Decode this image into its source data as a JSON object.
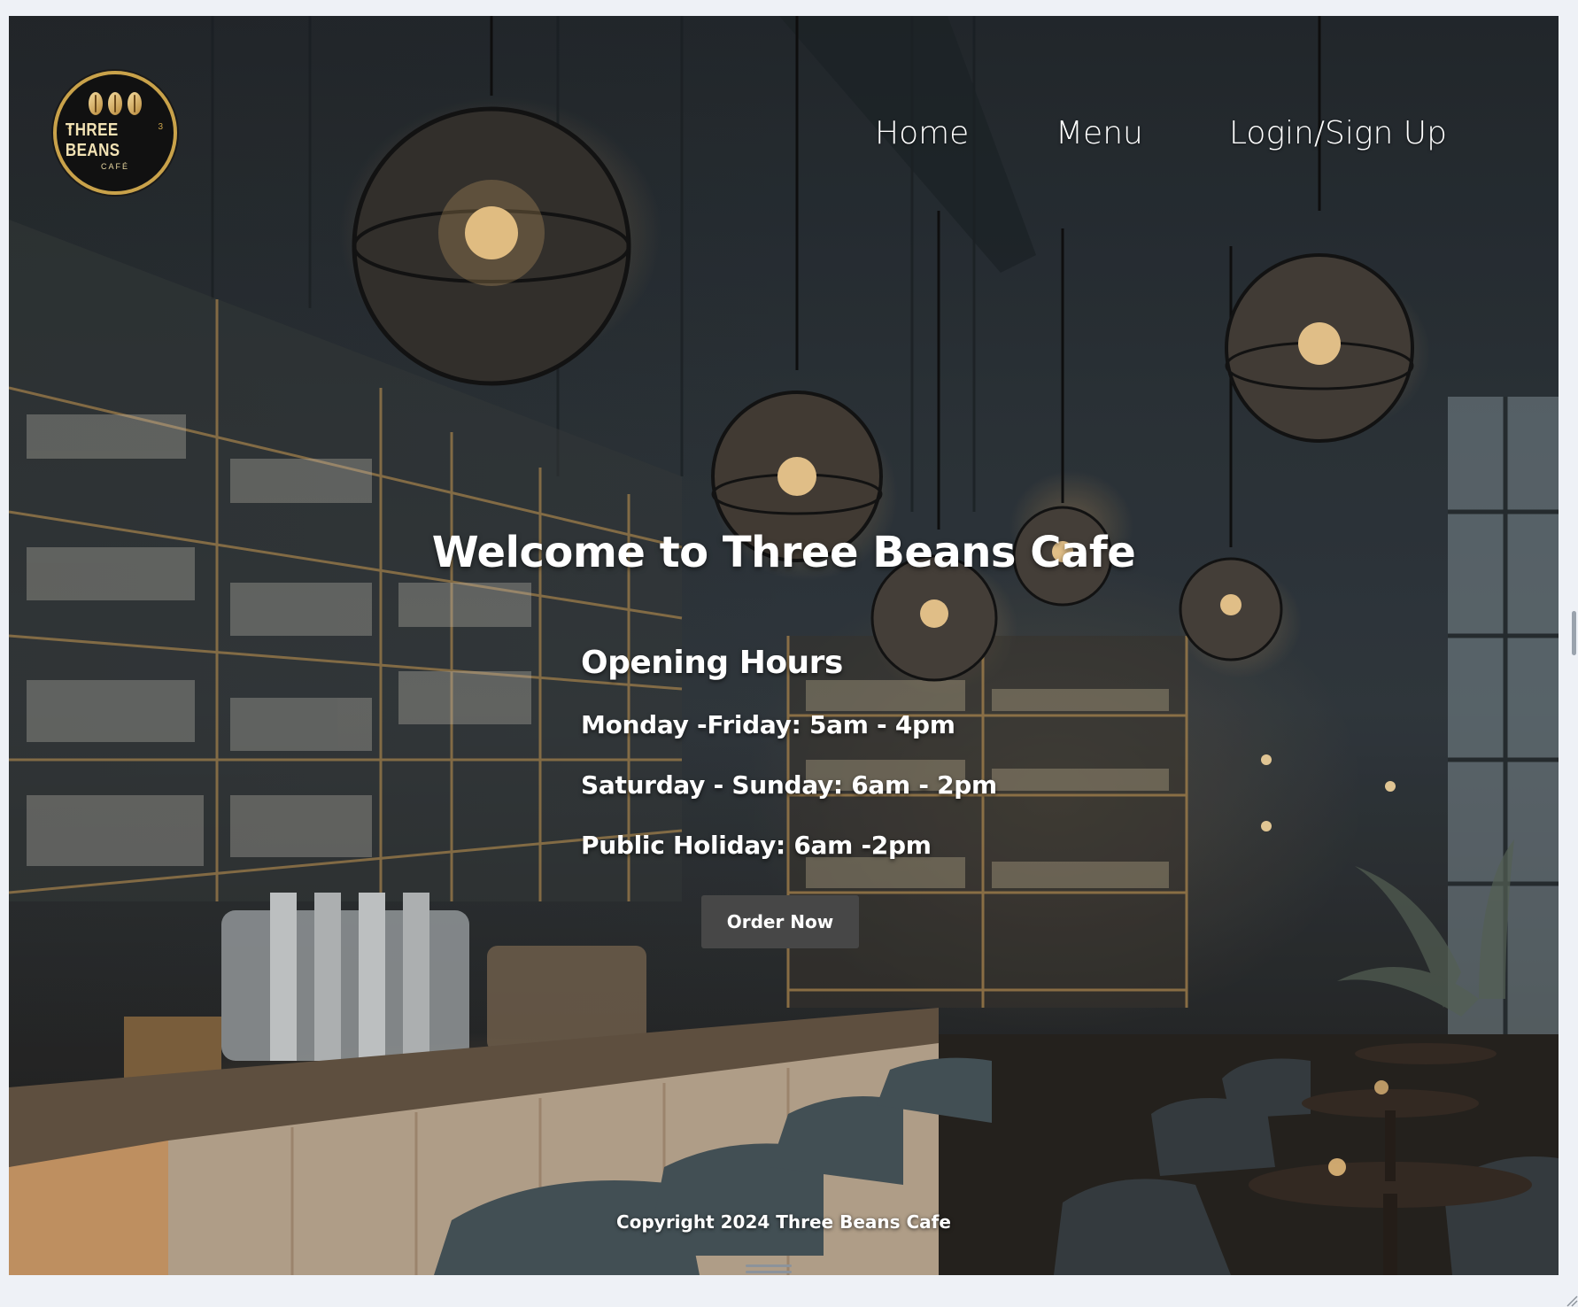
{
  "brand": {
    "logo_name": "THREE BEANS",
    "logo_sub": "CAFÉ",
    "logo_numbers": [
      "3",
      "3"
    ]
  },
  "nav": {
    "items": [
      {
        "label": "Home"
      },
      {
        "label": "Menu"
      },
      {
        "label": "Login/Sign Up"
      }
    ]
  },
  "hero": {
    "title": "Welcome to Three Beans Cafe"
  },
  "hours": {
    "heading": "Opening Hours",
    "lines": [
      "Monday -Friday: 5am - 4pm",
      "Saturday - Sunday: 6am - 2pm",
      "Public Holiday: 6am -2pm"
    ]
  },
  "cta": {
    "label": "Order Now"
  },
  "footer": {
    "copyright": "Copyright 2024 Three Beans Cafe"
  },
  "colors": {
    "button_bg": "#474747",
    "logo_gold": "#c9a24a",
    "page_bg": "#eef1f6"
  }
}
